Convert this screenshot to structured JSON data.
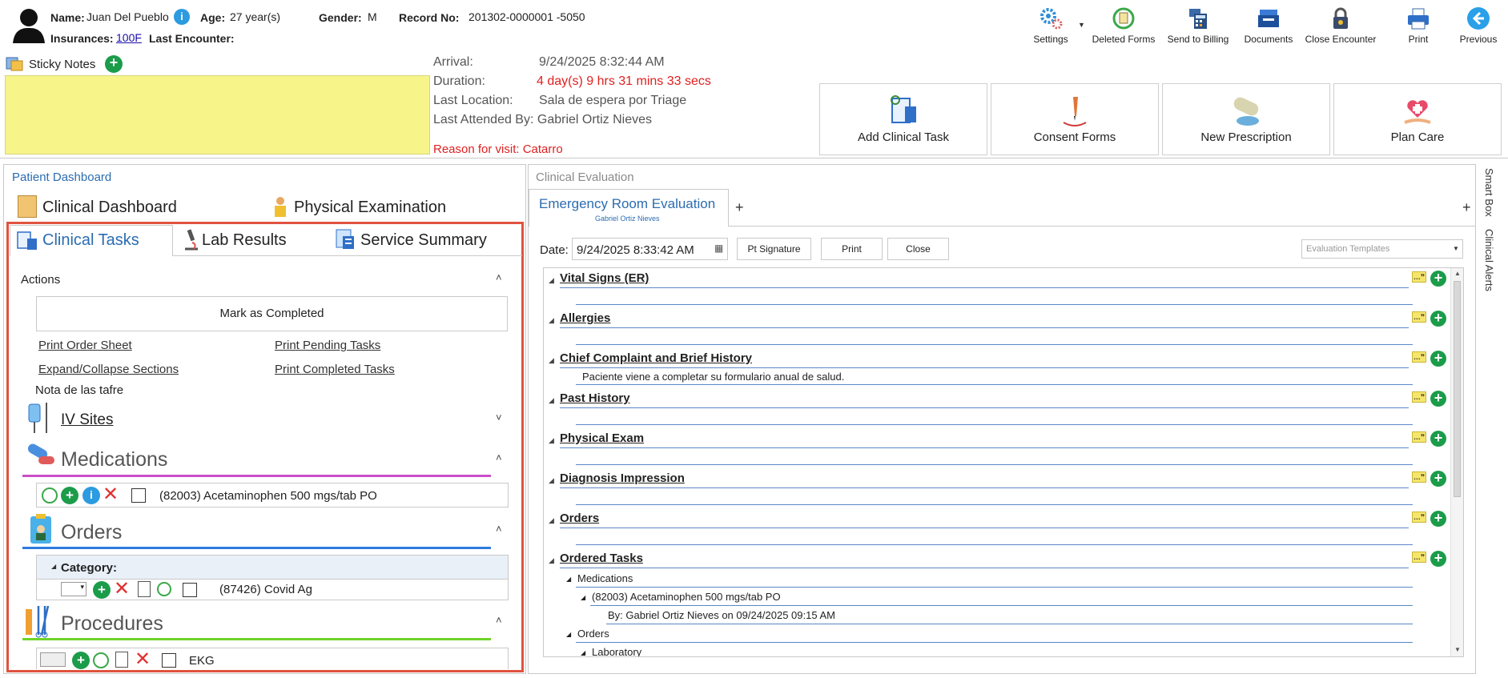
{
  "patient": {
    "name_label": "Name:",
    "name": "Juan Del Pueblo",
    "age_label": "Age:",
    "age": "27 year(s)",
    "gender_label": "Gender:",
    "gender": "M",
    "record_label": "Record No:",
    "record": "201302-0000001 -5050",
    "insurances_label": "Insurances:",
    "insurance": "100F",
    "last_encounter_label": "Last Encounter:"
  },
  "sticky_notes": {
    "label": "Sticky Notes"
  },
  "encounter": {
    "arrival_label": "Arrival:",
    "arrival": "9/24/2025 8:32:44 AM",
    "duration_label": "Duration:",
    "duration": "4 day(s) 9 hrs 31 mins 33 secs",
    "last_location_label": "Last Location:",
    "last_location": "Sala de espera por Triage",
    "last_attended": "Last Attended By: Gabriel Ortiz Nieves",
    "reason": "Reason for visit: Catarro"
  },
  "toolbar": {
    "settings": "Settings",
    "deleted_forms": "Deleted Forms",
    "send_to_billing": "Send to Billing",
    "documents": "Documents",
    "close_encounter": "Close Encounter",
    "print": "Print",
    "previous": "Previous"
  },
  "tiles": {
    "add_clinical_task": "Add Clinical Task",
    "consent_forms": "Consent Forms",
    "new_prescription": "New Prescription",
    "plan_care": "Plan Care"
  },
  "left": {
    "panel_title": "Patient Dashboard",
    "tab_clinical_dashboard": "Clinical Dashboard",
    "tab_physical_exam": "Physical Examination",
    "subtab_clinical_tasks": "Clinical Tasks",
    "subtab_lab_results": "Lab Results",
    "subtab_service_summary": "Service Summary",
    "actions_label": "Actions",
    "mark_completed": "Mark as Completed",
    "print_order_sheet": "Print Order Sheet",
    "print_pending": "Print Pending Tasks",
    "expand_collapse": "Expand/Collapse Sections",
    "print_completed": "Print Completed Tasks",
    "note": "Nota de las tafre",
    "iv_sites": "IV Sites",
    "medications": "Medications",
    "medication_item": "(82003) Acetaminophen 500 mgs/tab PO",
    "orders": "Orders",
    "category_label": "Category:",
    "order_item": "(87426) Covid Ag",
    "procedures": "Procedures",
    "procedure_item": "EKG"
  },
  "right": {
    "panel_title": "Clinical Evaluation",
    "tab_title": "Emergency Room Evaluation",
    "tab_author": "Gabriel Ortiz Nieves",
    "date_label": "Date:",
    "date_value": "9/24/2025 8:33:42 AM",
    "pt_signature": "Pt Signature",
    "print": "Print",
    "close": "Close",
    "templates_placeholder": "Evaluation Templates",
    "sections": [
      "Vital Signs (ER)",
      "Allergies",
      "Chief Complaint and Brief History",
      "Past History",
      "Physical Exam",
      "Diagnosis Impression",
      "Orders",
      "Ordered Tasks"
    ],
    "chief_complaint_text": "Paciente viene a completar su formulario anual de salud.",
    "tasks_medications": "Medications",
    "tasks_med_item": "(82003) Acetaminophen 500 mgs/tab PO",
    "tasks_med_by": "By: Gabriel Ortiz Nieves on 09/24/2025 09:15 AM",
    "tasks_orders": "Orders",
    "tasks_laboratory": "Laboratory"
  },
  "side_tabs": {
    "smart_box": "Smart Box",
    "clinical_alerts": "Clinical Alerts"
  },
  "colors": {
    "accent": "#2b6cb0",
    "highlight_border": "#e0533f",
    "sticky": "#f7f48a",
    "medications_line": "#c94fc9",
    "orders_line": "#2f7be0",
    "procedures_line": "#6fd42a",
    "duration_red": "#e02020"
  }
}
